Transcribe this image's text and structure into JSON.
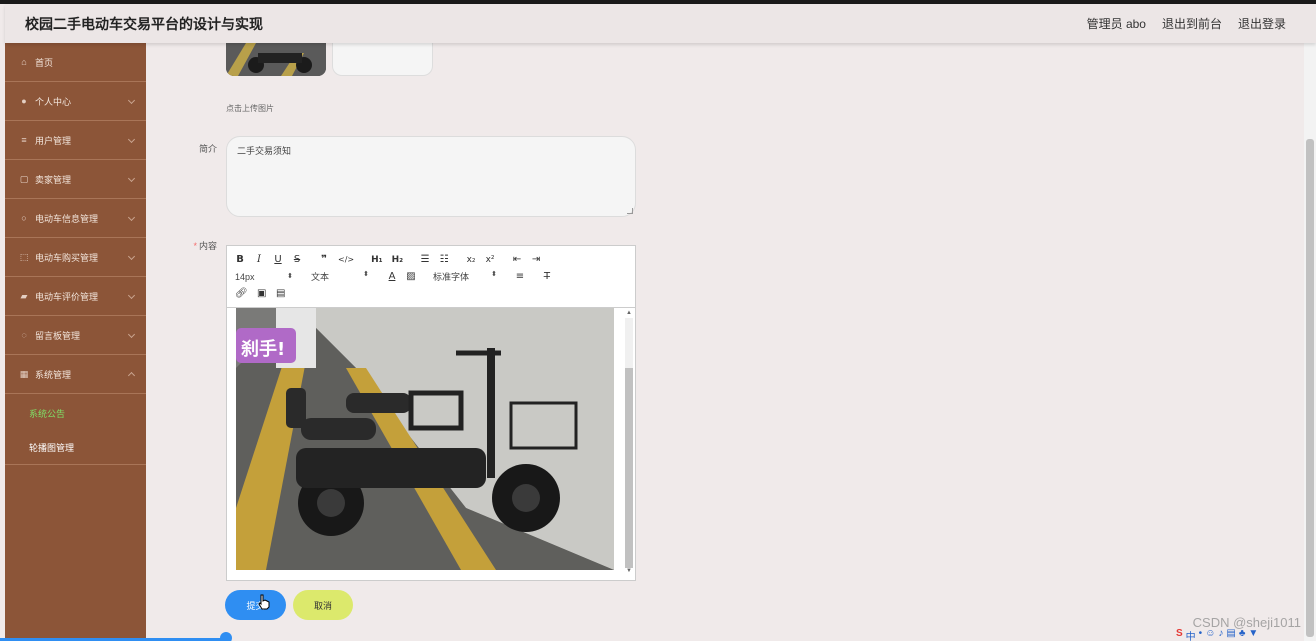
{
  "header": {
    "title": "校园二手电动车交易平台的设计与实现",
    "admin_label": "管理员 abo",
    "back_to_front": "退出到前台",
    "logout": "退出登录"
  },
  "sidebar": {
    "items": [
      {
        "label": "首页",
        "icon": "home-icon"
      },
      {
        "label": "个人中心",
        "icon": "person-icon"
      },
      {
        "label": "用户管理",
        "icon": "list-icon"
      },
      {
        "label": "卖家管理",
        "icon": "copy-icon"
      },
      {
        "label": "电动车信息管理",
        "icon": "power-icon"
      },
      {
        "label": "电动车购买管理",
        "icon": "frame-icon"
      },
      {
        "label": "电动车评价管理",
        "icon": "thumb-icon"
      },
      {
        "label": "留言板管理",
        "icon": "chat-icon"
      },
      {
        "label": "系统管理",
        "icon": "grid-icon"
      }
    ],
    "submenu": [
      {
        "label": "系统公告",
        "active": true
      },
      {
        "label": "轮播图管理",
        "active": false
      }
    ]
  },
  "form": {
    "upload_hint": "点击上传图片",
    "intro_label": "简介",
    "intro_value": "二手交易须知",
    "content_label": "内容",
    "required_mark": "*",
    "submit_label": "提交",
    "cancel_label": "取消"
  },
  "editor": {
    "font_size": "14px",
    "block_format": "文本",
    "font_family": "标准字体",
    "sticker_text": "刹手!"
  },
  "watermark": "CSDN @sheji1011",
  "colors": {
    "sidebar": "#8c5538",
    "active_sub": "#7fe067",
    "submit": "#2f8ef2",
    "cancel": "#dce96c"
  }
}
